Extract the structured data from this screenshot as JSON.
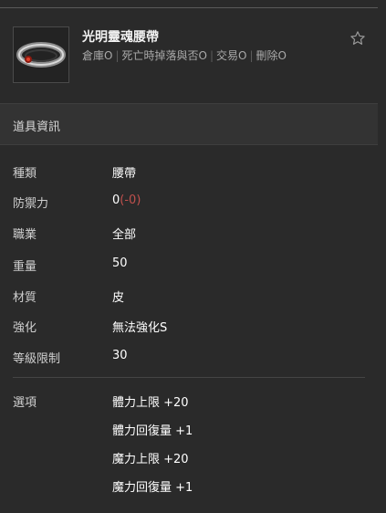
{
  "item": {
    "name": "光明靈魂腰帶",
    "flags": [
      "倉庫O",
      "死亡時掉落與否O",
      "交易O",
      "刪除O"
    ],
    "favorite_icon": "star-outline-icon",
    "thumbnail_icon": "belt-icon"
  },
  "section": {
    "title": "道具資訊"
  },
  "stats": [
    {
      "label": "種類",
      "value": "腰帶"
    },
    {
      "label": "防禦力",
      "value": "0",
      "delta": "(-0)"
    },
    {
      "label": "職業",
      "value": "全部"
    },
    {
      "label": "重量",
      "value": "50"
    },
    {
      "label": "材質",
      "value": "皮"
    },
    {
      "label": "強化",
      "value": "無法強化S"
    },
    {
      "label": "等級限制",
      "value": "30"
    }
  ],
  "options": {
    "label": "選項",
    "values": [
      "體力上限 +20",
      "體力回復量 +1",
      "魔力上限 +20",
      "魔力回復量 +1"
    ]
  },
  "colors": {
    "background": "#2a2a2a",
    "section_bar": "#333333",
    "delta_negative": "#c0504d"
  }
}
